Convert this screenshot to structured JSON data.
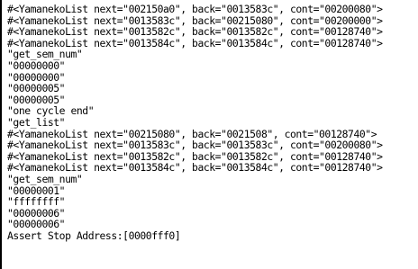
{
  "console": {
    "lines": [
      "#<YamanekoList next=\"002150a0\", back=\"0013583c\", cont=\"00200080\">",
      "#<YamanekoList next=\"0013583c\", back=\"00215080\", cont=\"00200000\">",
      "#<YamanekoList next=\"0013582c\", back=\"0013582c\", cont=\"00128740\">",
      "#<YamanekoList next=\"0013584c\", back=\"0013584c\", cont=\"00128740\">",
      "\"get_sem_num\"",
      "\"00000000\"",
      "\"00000000\"",
      "\"00000005\"",
      "\"00000005\"",
      "\"one cycle end\"",
      "\"get_list\"",
      "#<YamanekoList next=\"00215080\", back=\"0021508\", cont=\"00128740\">",
      "#<YamanekoList next=\"0013583c\", back=\"0013583c\", cont=\"00200080\">",
      "#<YamanekoList next=\"0013582c\", back=\"0013582c\", cont=\"00128740\">",
      "#<YamanekoList next=\"0013584c\", back=\"0013584c\", cont=\"00128740\">",
      "\"get_sem_num\"",
      "\"00000001\"",
      "\"ffffffff\"",
      "\"00000006\"",
      "\"00000006\"",
      "Assert Stop Address:[0000fff0]"
    ]
  }
}
